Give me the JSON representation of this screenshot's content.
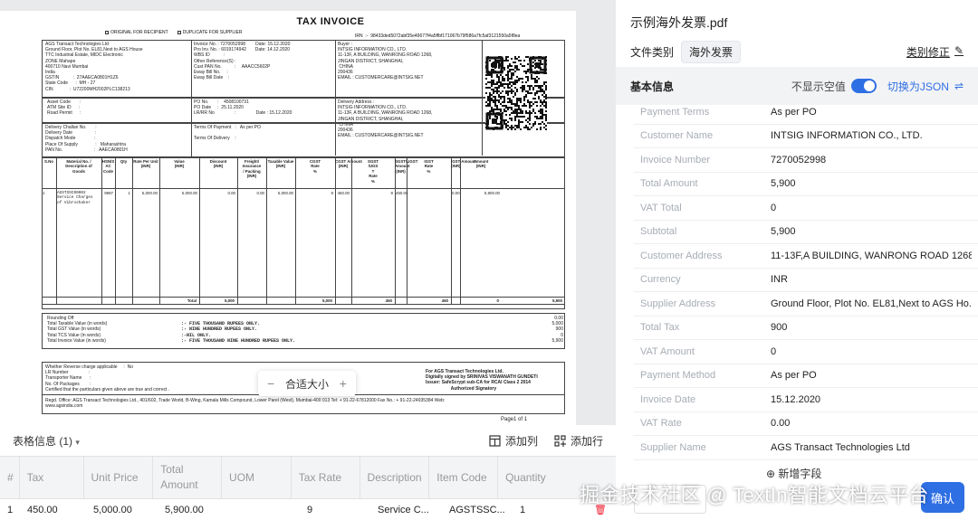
{
  "document": {
    "title": "TAX INVOICE",
    "copy_original": "ORIGINAL FOR RECIPIENT",
    "copy_duplicate": "DUPLICATE FOR SUPPLIER",
    "irn": "IRN  :-  98433ded5072abf35e49677f4a5ffbf171067b79f586a7fc5af3121550a5f8ea",
    "supplier_block": "AGS Transact Technologies Ltd\nGround Floor, Plot No. EL81,Next to AGS House\nTTC Industrial Estate, MIDC Electronic\nZONE Mahape\n400710 Navi Mumbai\nIndia\nGSTIN           :  27AAECA0801H1Z6\nState Code      :  MH - 27\nCIN             :  U72200MH2002PLC138213",
    "invoice_block": "Invoice No. : 7270052998        Date: 15.12.2020\nPro Inv. No. : 6019174942       Date: 14.12.2020\nWBS ID           :\nOther Reference(S) :\nCust PAN No.          :     AAACC5602P\nEway Bill No.     :\nEway Bill Date    :",
    "buyer_block": "Buyer :\nINTSIG INFORMATION CO., LTD.\n11-13F, A BUILDING, WANRONG ROAD 1268,\nJINGAN DISTRICT, SHANGHAI,\n CHINA\n200436\nEMAIL : CUSTOMERCARE@INTSIG.NET",
    "asset_block": "Asset Code       :\nATM Site ID      :\nRoad Permit      :",
    "po_block": "PO No.       :    4508100731\nPO Date     :  25.11.2020\nLR/RR No                :                Date : 15.12.2020",
    "delivery_block": "Delivery Address :\nINTSIG INFORMATION CO., LTD.\n11-13F, A BUILDING, WANRONG ROAD 1268,\nJINGAN DISTRICT, SHANGHAI,\n CHINA\n200436\nEMAIL : CUSTOMERCARE@INTSIG.NET",
    "dispatch_block": "Delivery Challan No.       :\nDelivery Date                  :\nDispatch Mode               :\nPlace Of Supply              :   Maharashtra\nPAN No.                         :   AAECA0801H",
    "terms_block": "Terms Of Payment   :   As per PO\n\nTerms Of Delivery    :",
    "table_headers": [
      "S.No",
      "Material No. /\nDescription of\nGoods",
      "HSN/S\nAC\nCode",
      "Qty",
      "Rate Per Unit\n(INR)",
      "Value\n(INR)",
      "Discount\n(INR)",
      "Freight/\nInsurance\n/ Packing\n(INR)",
      "Taxable Value\n(INR)",
      "CGST\nRate\n%",
      "CGST Amount\n(INR)",
      "SGST\n/UGS\nT\nRate\n%",
      "SGST/UGST\nAmount\n(INR)",
      "IGST\nRate\n%",
      "IGST Amount\n(INR)",
      "Amount\n(INR)"
    ],
    "table_row": [
      "1",
      "AGSTSSC00002\nService Charges\nof Vibroshaker",
      "9987",
      "1",
      "5,000.00",
      "5,000.00",
      "0.00",
      "0.00",
      "5,000.00",
      "9",
      "450.00",
      "9",
      "450.00",
      "",
      "0.00",
      "5,900.00"
    ],
    "total_row": [
      "Total",
      "5,000",
      "",
      "",
      "5,000",
      "",
      "450",
      "",
      "450",
      "",
      "0",
      "5,900"
    ],
    "summary_labels": "Rounding Off\nTotal Taxable Value (in words)\nTotal GST Value (in words)\nTotal TCS Value (in words)\nTotal Invoice Value (in words)",
    "summary_words": "\n:- FIVE THOUSAND RUPEES ONLY.\n:- NINE HUNDRED RUPEES ONLY.\n:-NIL ONLY.\n:- FIVE THOUSAND NINE HUNDRED RUPEES ONLY.",
    "summary_values": "0.00\n5,000\n900\n0\n5,900",
    "reverse_block": "Whether Reverse charge applicable     :  No\nLR Number                :\nTransporter Name      :\nNo. Of Packages        :\nCertified that the particulars given above are true and correct .",
    "signatory_block": "For AGS Transact Technologies Ltd.\nDigitally signed by SRINIVAS VISWANATH GUNDETI\nIssuer: SafeScrypt sub-CA for RCAI Class 2 2014\n                    Authorized Signatory",
    "regd_office": "Regd. Office: AGS Transact Technologies Ltd., 401/602, Trade World, B-Wing, Kamala Mills Compound, Lower Parel (West), Mumbai-400 013 Tel: + 91-22-67812000 Fax No.: + 91-22-24935384 Web:\nwww.agsindia.com",
    "page_of": "Page1   of   1"
  },
  "viewer": {
    "zoom_label": "合适大小",
    "zoom_out": "−",
    "zoom_in": "+"
  },
  "table_info": {
    "title": "表格信息 (1)",
    "add_column": "添加列",
    "add_row": "添加行",
    "headers": [
      "#",
      "Tax",
      "Unit Price",
      "Total\nAmount",
      "UOM",
      "Tax Rate",
      "Description",
      "Item Code",
      "Quantity"
    ],
    "rows": [
      [
        "1",
        "450.00",
        "5,000.00",
        "5,900.00",
        "",
        "9",
        "Service C...",
        "AGSTSSC...",
        "1"
      ]
    ]
  },
  "panel": {
    "file_name": "示例海外发票.pdf",
    "category_label": "文件类别",
    "category_value": "海外发票",
    "correct_label": "类别修正",
    "basic_info": "基本信息",
    "hide_empty": "不显示空值",
    "switch_json": "切换为JSON",
    "add_field": "新增字段",
    "confirm": "确认",
    "watermark": "掘金技术社区 @ TextIn智能文档云平台",
    "fields": [
      {
        "key": "Payment Terms",
        "value": "As per PO"
      },
      {
        "key": "Customer Name",
        "value": "INTSIG INFORMATION CO., LTD."
      },
      {
        "key": "Invoice Number",
        "value": "7270052998"
      },
      {
        "key": "Total Amount",
        "value": "5,900"
      },
      {
        "key": "VAT Total",
        "value": "0"
      },
      {
        "key": "Subtotal",
        "value": "5,900"
      },
      {
        "key": "Customer Address",
        "value": "11-13F,A BUILDING, WANRONG ROAD 1268,..."
      },
      {
        "key": "Currency",
        "value": "INR"
      },
      {
        "key": "Supplier Address",
        "value": "Ground Floor, Plot No. EL81,Next to AGS Ho..."
      },
      {
        "key": "Total Tax",
        "value": "900"
      },
      {
        "key": "VAT Amount",
        "value": "0"
      },
      {
        "key": "Payment Method",
        "value": "As per PO"
      },
      {
        "key": "Invoice Date",
        "value": "15.12.2020"
      },
      {
        "key": "VAT Rate",
        "value": "0.00"
      },
      {
        "key": "Supplier Name",
        "value": "AGS Transact Technologies Ltd"
      }
    ]
  },
  "colors": {
    "accent": "#2f6fe4",
    "muted_key": "#a7acb3",
    "delete": "#e23333"
  }
}
